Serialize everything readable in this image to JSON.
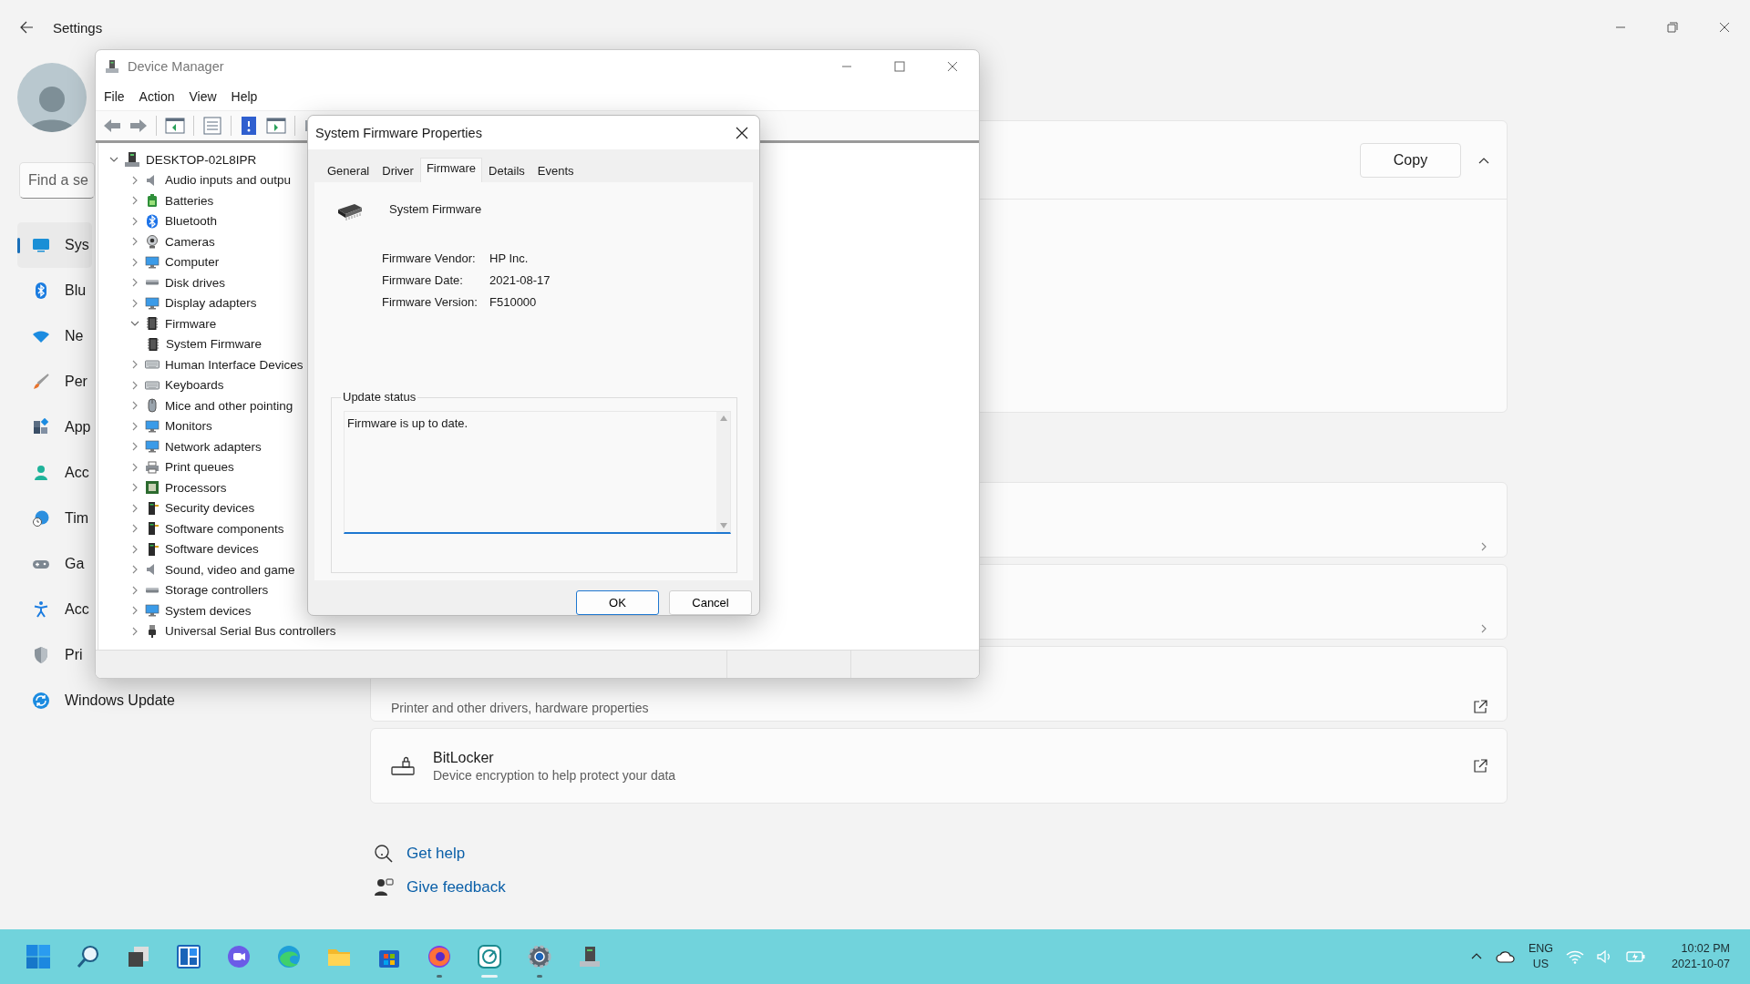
{
  "settings": {
    "title": "Settings",
    "search": {
      "placeholder": "Find a se"
    },
    "nav": [
      {
        "label": "Sys",
        "selected": true
      },
      {
        "label": "Blu",
        "selected": false
      },
      {
        "label": "Ne",
        "selected": false
      },
      {
        "label": "Per",
        "selected": false
      },
      {
        "label": "App",
        "selected": false
      },
      {
        "label": "Acc",
        "selected": false
      },
      {
        "label": "Tim",
        "selected": false
      },
      {
        "label": "Ga",
        "selected": false
      },
      {
        "label": "Acc",
        "selected": false
      },
      {
        "label": "Pri",
        "selected": false
      },
      {
        "label": "Windows Update",
        "selected": false
      }
    ],
    "spec_card": {
      "button": "Copy",
      "expanded": true
    },
    "rows": [
      {
        "kind": "nav"
      },
      {
        "kind": "nav"
      },
      {
        "kind": "external",
        "subtitle": "Printer and other drivers, hardware properties"
      },
      {
        "kind": "external",
        "title": "BitLocker",
        "subtitle": "Device encryption to help protect your data"
      }
    ],
    "help_links": [
      "Get help",
      "Give feedback"
    ]
  },
  "device_manager": {
    "title": "Device Manager",
    "menu": [
      "File",
      "Action",
      "View",
      "Help"
    ],
    "tree": {
      "label": "DESKTOP-02L8IPR",
      "expanded": true,
      "children": [
        {
          "label": "Audio inputs and outpu",
          "expanded": false
        },
        {
          "label": "Batteries",
          "expanded": false
        },
        {
          "label": "Bluetooth",
          "expanded": false
        },
        {
          "label": "Cameras",
          "expanded": false
        },
        {
          "label": "Computer",
          "expanded": false
        },
        {
          "label": "Disk drives",
          "expanded": false
        },
        {
          "label": "Display adapters",
          "expanded": false
        },
        {
          "label": "Firmware",
          "expanded": true,
          "children": [
            {
              "label": "System Firmware"
            }
          ]
        },
        {
          "label": "Human Interface Devices",
          "expanded": false
        },
        {
          "label": "Keyboards",
          "expanded": false
        },
        {
          "label": "Mice and other pointing",
          "expanded": false
        },
        {
          "label": "Monitors",
          "expanded": false
        },
        {
          "label": "Network adapters",
          "expanded": false
        },
        {
          "label": "Print queues",
          "expanded": false
        },
        {
          "label": "Processors",
          "expanded": false
        },
        {
          "label": "Security devices",
          "expanded": false
        },
        {
          "label": "Software components",
          "expanded": false
        },
        {
          "label": "Software devices",
          "expanded": false
        },
        {
          "label": "Sound, video and game",
          "expanded": false
        },
        {
          "label": "Storage controllers",
          "expanded": false
        },
        {
          "label": "System devices",
          "expanded": false
        },
        {
          "label": "Universal Serial Bus controllers",
          "expanded": false
        }
      ]
    }
  },
  "dialog": {
    "title": "System Firmware Properties",
    "tabs": [
      {
        "label": "General",
        "selected": false
      },
      {
        "label": "Driver",
        "selected": false
      },
      {
        "label": "Firmware",
        "selected": true
      },
      {
        "label": "Details",
        "selected": false
      },
      {
        "label": "Events",
        "selected": false
      }
    ],
    "device_name": "System Firmware",
    "fields": [
      {
        "label": "Firmware Vendor:",
        "value": "HP Inc."
      },
      {
        "label": "Firmware Date:",
        "value": "2021-08-17"
      },
      {
        "label": "Firmware Version:",
        "value": "F510000"
      }
    ],
    "update_status": {
      "legend": "Update status",
      "value": "Firmware is up to date."
    },
    "buttons": [
      "OK",
      "Cancel"
    ]
  },
  "taskbar": {
    "apps": [
      {
        "running": false,
        "active": false
      },
      {
        "running": false,
        "active": false
      },
      {
        "running": false,
        "active": false
      },
      {
        "running": false,
        "active": false
      },
      {
        "running": false,
        "active": false
      },
      {
        "running": false,
        "active": false
      },
      {
        "running": false,
        "active": false
      },
      {
        "running": false,
        "active": false
      },
      {
        "running": true,
        "active": false
      },
      {
        "running": true,
        "active": true
      },
      {
        "running": true,
        "active": false
      },
      {
        "running": false,
        "active": false
      }
    ],
    "tray": {
      "language": "ENG",
      "region": "US",
      "time": "10:02 PM",
      "date": "2021-10-07"
    }
  }
}
